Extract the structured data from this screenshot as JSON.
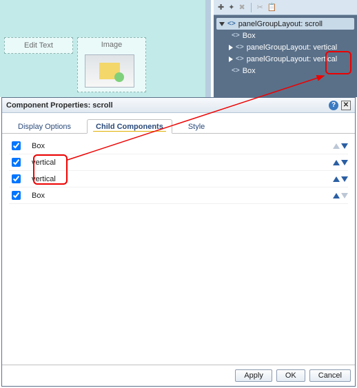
{
  "design": {
    "cells": [
      {
        "label": "Edit Text"
      },
      {
        "label": "Image"
      }
    ]
  },
  "toolbar": {
    "icons": [
      "plus",
      "sparkle",
      "delete",
      "cut",
      "paste"
    ]
  },
  "tree": {
    "root": {
      "label": "panelGroupLayout: scroll"
    },
    "children": [
      {
        "label": "Box",
        "expandable": false
      },
      {
        "label": "panelGroupLayout: vertical",
        "expandable": true
      },
      {
        "label": "panelGroupLayout: vertical",
        "expandable": true
      },
      {
        "label": "Box",
        "expandable": false
      }
    ]
  },
  "dialog": {
    "title": "Component Properties: scroll",
    "tabs": [
      {
        "label": "Display Options",
        "active": false
      },
      {
        "label": "Child Components",
        "active": true
      },
      {
        "label": "Style",
        "active": false
      }
    ],
    "rows": [
      {
        "label": "Box",
        "checked": true,
        "upEnabled": false,
        "downEnabled": true
      },
      {
        "label": "vertical",
        "checked": true,
        "upEnabled": true,
        "downEnabled": true
      },
      {
        "label": "vertical",
        "checked": true,
        "upEnabled": true,
        "downEnabled": true
      },
      {
        "label": "Box",
        "checked": true,
        "upEnabled": true,
        "downEnabled": false
      }
    ],
    "buttons": {
      "apply": "Apply",
      "ok": "OK",
      "cancel": "Cancel"
    }
  }
}
